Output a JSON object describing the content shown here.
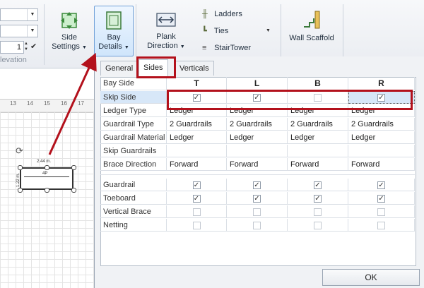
{
  "ribbon": {
    "field1_value": "",
    "field2_value": "",
    "field3_value": "1",
    "elevation_label": "levation",
    "side_settings": {
      "line1": "Side",
      "line2": "Settings"
    },
    "bay_details": {
      "line1": "Bay",
      "line2": "Details"
    },
    "plank_direction": {
      "line1": "Plank",
      "line2": "Direction"
    },
    "ladders_label": "Ladders",
    "ties_label": "Ties",
    "stairtower_label": "StairTower",
    "wall_scaffold_label": "Wall Scaffold"
  },
  "ruler": {
    "ticks": [
      "13",
      "14",
      "15",
      "16",
      "17"
    ]
  },
  "drawing": {
    "dim_top": "2.44 m.",
    "dim_left": "1.22 m.",
    "center_label": "4P"
  },
  "dialog": {
    "tabs": [
      "General",
      "Sides",
      "Verticals"
    ],
    "selected_tab": "Sides",
    "columns": [
      "T",
      "L",
      "B",
      "R"
    ],
    "corner_label": "Bay Side",
    "rows1": [
      {
        "label": "Skip Side",
        "type": "check",
        "values": [
          true,
          true,
          false,
          true
        ]
      },
      {
        "label": "Ledger Type",
        "type": "text",
        "values": [
          "Ledger",
          "Ledger",
          "Ledger",
          "Ledger"
        ]
      },
      {
        "label": "Guardrail Type",
        "type": "text",
        "values": [
          "2 Guardrails",
          "2 Guardrails",
          "2 Guardrails",
          "2 Guardrails"
        ]
      },
      {
        "label": "Guardrail Material",
        "type": "text",
        "values": [
          "Ledger",
          "Ledger",
          "Ledger",
          "Ledger"
        ]
      },
      {
        "label": "Skip Guardrails",
        "type": "text",
        "values": [
          "",
          "",
          "",
          ""
        ]
      },
      {
        "label": "Brace Direction",
        "type": "text",
        "values": [
          "Forward",
          "Forward",
          "Forward",
          "Forward"
        ]
      }
    ],
    "rows2": [
      {
        "label": "Guardrail",
        "values": [
          true,
          true,
          true,
          true
        ]
      },
      {
        "label": "Toeboard",
        "values": [
          true,
          true,
          true,
          true
        ]
      },
      {
        "label": "Vertical Brace",
        "values": [
          false,
          false,
          false,
          false
        ]
      },
      {
        "label": "Netting",
        "values": [
          false,
          false,
          false,
          false
        ]
      }
    ],
    "ok_label": "OK"
  },
  "colors": {
    "annotation_red": "#b3111c",
    "selection_blue": "#d7e7f8"
  }
}
